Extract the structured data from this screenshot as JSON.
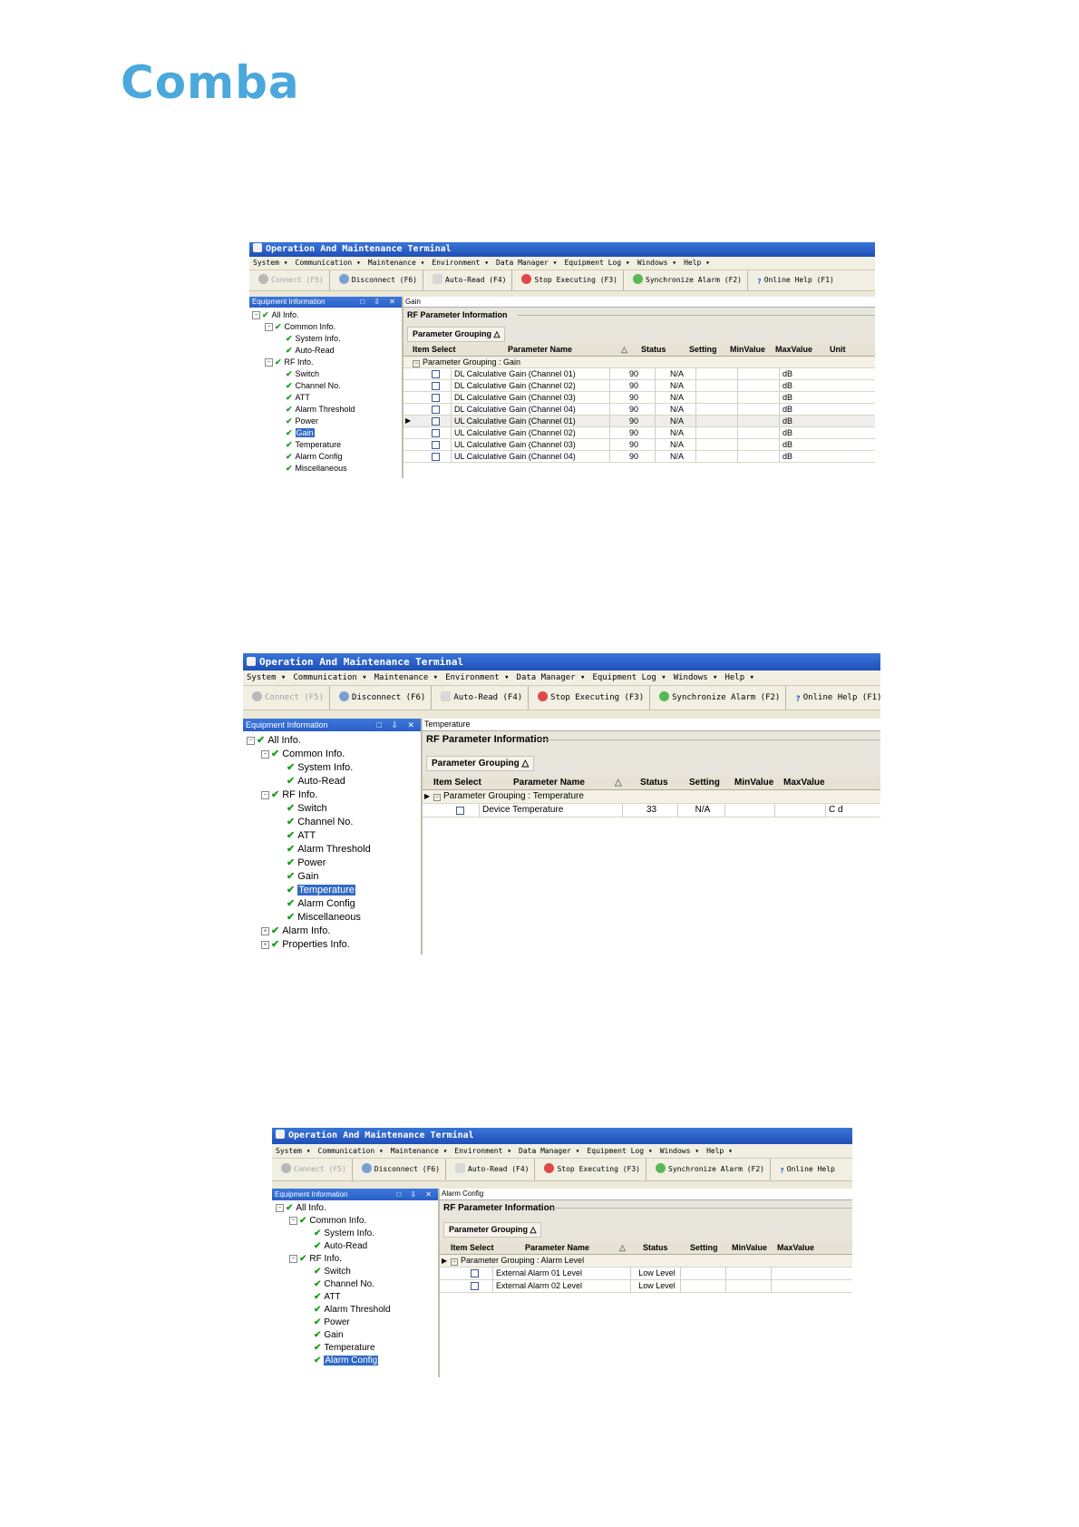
{
  "logo": {
    "text": "Comba",
    "color": "#4aa8dc"
  },
  "app": {
    "title": "Operation And Maintenance Terminal",
    "menu": [
      "System ▾",
      "Communication ▾",
      "Maintenance ▾",
      "Environment ▾",
      "Data Manager ▾",
      "Equipment Log ▾",
      "Windows ▾",
      "Help ▾"
    ],
    "toolbar": {
      "connect": "Connect (F5)",
      "disconnect": "Disconnect (F6)",
      "auto_read": "Auto-Read (F4)",
      "stop": "Stop Executing (F3)",
      "sync": "Synchronize Alarm (F2)",
      "help": "Online Help (F1)",
      "help_cut": "Online Help"
    },
    "left_pane_title": "Equipment Information",
    "pane_buttons": "□ ⇩ ✕",
    "rf_title": "RF Parameter Information",
    "group_box": "Parameter Grouping △",
    "headers": [
      "Item Select",
      "Parameter Name",
      "Status",
      "Setting",
      "MinValue",
      "MaxValue",
      "Unit"
    ],
    "sort_glyph": "△",
    "tree": {
      "all": "All Info.",
      "common": "Common Info.",
      "system": "System Info.",
      "auto_read": "Auto-Read",
      "rf": "RF Info.",
      "switch": "Switch",
      "channel": "Channel No.",
      "att": "ATT",
      "alarm_threshold": "Alarm Threshold",
      "power": "Power",
      "gain": "Gain",
      "temperature": "Temperature",
      "alarm_config": "Alarm Config",
      "misc": "Miscellaneous",
      "alarm_info": "Alarm Info.",
      "properties": "Properties Info."
    }
  },
  "shot1": {
    "breadcrumb": "Gain",
    "group_label": "Parameter Grouping : Gain",
    "rows": [
      {
        "name": "DL Calculative Gain (Channel 01)",
        "status": "90",
        "setting": "N/A",
        "unit": "dB"
      },
      {
        "name": "DL Calculative Gain (Channel 02)",
        "status": "90",
        "setting": "N/A",
        "unit": "dB"
      },
      {
        "name": "DL Calculative Gain (Channel 03)",
        "status": "90",
        "setting": "N/A",
        "unit": "dB"
      },
      {
        "name": "DL Calculative Gain (Channel 04)",
        "status": "90",
        "setting": "N/A",
        "unit": "dB"
      },
      {
        "name": "UL Calculative Gain (Channel 01)",
        "status": "90",
        "setting": "N/A",
        "unit": "dB"
      },
      {
        "name": "UL Calculative Gain (Channel 02)",
        "status": "90",
        "setting": "N/A",
        "unit": "dB"
      },
      {
        "name": "UL Calculative Gain (Channel 03)",
        "status": "90",
        "setting": "N/A",
        "unit": "dB"
      },
      {
        "name": "UL Calculative Gain (Channel 04)",
        "status": "90",
        "setting": "N/A",
        "unit": "dB"
      }
    ]
  },
  "shot2": {
    "breadcrumb": "Temperature",
    "group_label": "Parameter Grouping : Temperature",
    "rows": [
      {
        "name": "Device Temperature",
        "status": "33",
        "setting": "N/A",
        "unit": "C d"
      }
    ]
  },
  "shot3": {
    "breadcrumb": "Alarm Config",
    "group_label": "Parameter Grouping : Alarm Level",
    "rows": [
      {
        "name": "External Alarm 01 Level",
        "status": "Low Level",
        "setting": ""
      },
      {
        "name": "External Alarm 02 Level",
        "status": "Low Level",
        "setting": ""
      }
    ]
  },
  "colors": {
    "titlebar": "#2a5fc8",
    "tree_check": "#18a018",
    "selection": "#316ac5"
  }
}
